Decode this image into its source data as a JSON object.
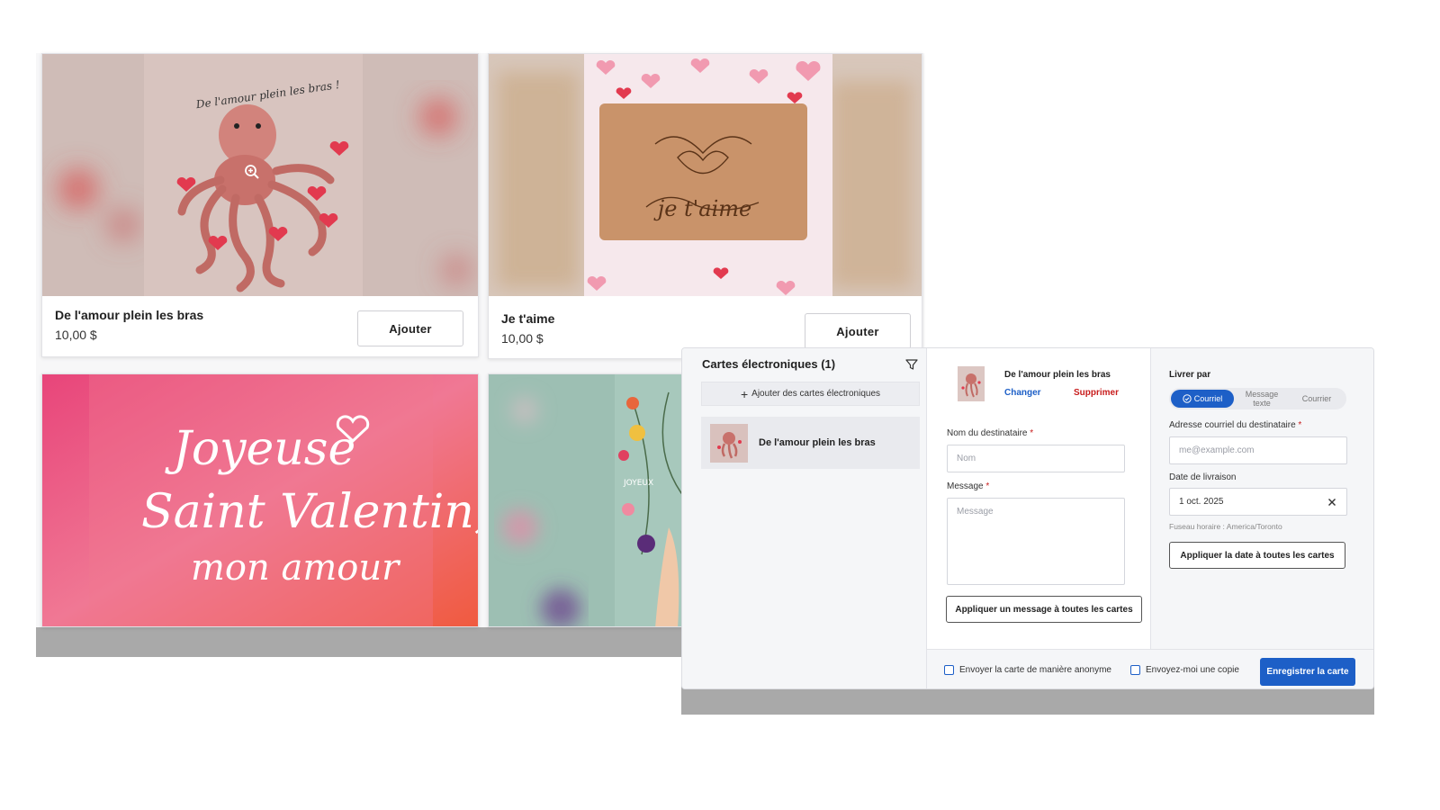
{
  "products": [
    {
      "name": "De l'amour plein les bras",
      "price": "10,00 $",
      "add_label": "Ajouter",
      "art_text": "De l'amour plein les bras !"
    },
    {
      "name": "Je t'aime",
      "price": "10,00 $",
      "add_label": "Ajouter",
      "art_text": "je t'aime"
    },
    {
      "art_text_line1": "Joyeuse",
      "art_text_line2": "Saint Valentin,",
      "art_text_line3": "mon amour"
    },
    {
      "art_text": "JOYEUX"
    }
  ],
  "ecards": {
    "title": "Cartes électroniques (1)",
    "add_button": "Ajouter des cartes électroniques",
    "items": [
      {
        "name": "De l'amour plein les bras"
      }
    ]
  },
  "editor": {
    "card_name": "De l'amour plein les bras",
    "change_label": "Changer",
    "delete_label": "Supprimer",
    "recipient_name_label": "Nom du destinataire",
    "recipient_name_placeholder": "Nom",
    "message_label": "Message",
    "message_placeholder": "Message",
    "apply_message_button": "Appliquer un message à toutes les cartes",
    "required_mark": "*"
  },
  "delivery": {
    "label": "Livrer par",
    "options": [
      "Courriel",
      "Message texte",
      "Courrier"
    ],
    "selected": "Courriel",
    "email_label": "Adresse courriel du destinataire",
    "email_placeholder": "me@example.com",
    "date_label": "Date de livraison",
    "date_value": "1 oct. 2025",
    "timezone": "Fuseau horaire : America/Toronto",
    "apply_date_button": "Appliquer la date à toutes les cartes"
  },
  "footer": {
    "anonymous_label": "Envoyer la carte de manière anonyme",
    "copy_label": "Envoyez-moi une copie",
    "save_button": "Enregistrer la carte"
  },
  "colors": {
    "accent": "#1d5fc7",
    "danger": "#c81d1d",
    "heart": "#e23a4f"
  }
}
